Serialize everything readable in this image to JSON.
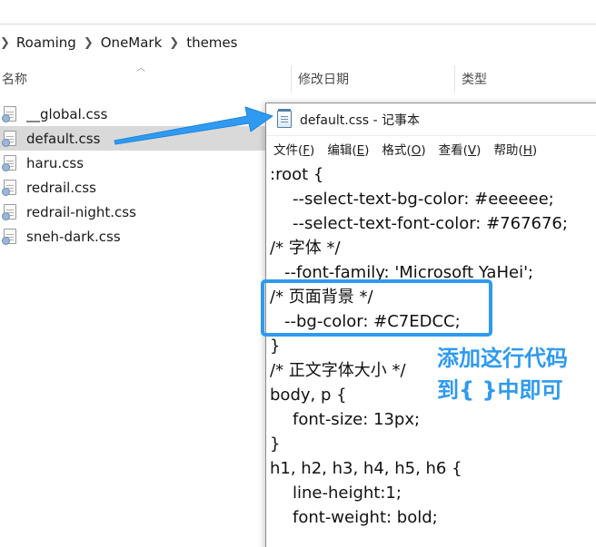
{
  "explorer": {
    "breadcrumb": [
      "Roaming",
      "OneMark",
      "themes"
    ],
    "columns": {
      "name": "名称",
      "date": "修改日期",
      "type": "类型"
    },
    "files": [
      {
        "name": "__global.css",
        "selected": false
      },
      {
        "name": "default.css",
        "selected": true
      },
      {
        "name": "haru.css",
        "selected": false
      },
      {
        "name": "redrail.css",
        "selected": false
      },
      {
        "name": "redrail-night.css",
        "selected": false
      },
      {
        "name": "sneh-dark.css",
        "selected": false
      }
    ]
  },
  "notepad": {
    "title": "default.css - 记事本",
    "menu": [
      {
        "label": "文件",
        "key": "F"
      },
      {
        "label": "编辑",
        "key": "E"
      },
      {
        "label": "格式",
        "key": "O"
      },
      {
        "label": "查看",
        "key": "V"
      },
      {
        "label": "帮助",
        "key": "H"
      }
    ],
    "lines": [
      ":root {",
      "--select-text-bg-color: #eeeeee;",
      "--select-text-font-color: #767676;",
      "/* 字体 */",
      "--font-family: 'Microsoft YaHei';",
      "/* 页面背景 */",
      "--bg-color: #C7EDCC;",
      "}",
      "/* 正文字体大小 */",
      "body, p {",
      "font-size: 13px;",
      "}",
      "h1, h2, h3, h4, h5, h6 {",
      "line-height:1;",
      "font-weight: bold;"
    ]
  },
  "annotation": {
    "note_line1": "添加这行代码",
    "note_line2": "到{ }中即可",
    "color": "#2f9af0"
  },
  "colors": {
    "accent": "#2f9af0",
    "selection": "#d9d9d9"
  }
}
